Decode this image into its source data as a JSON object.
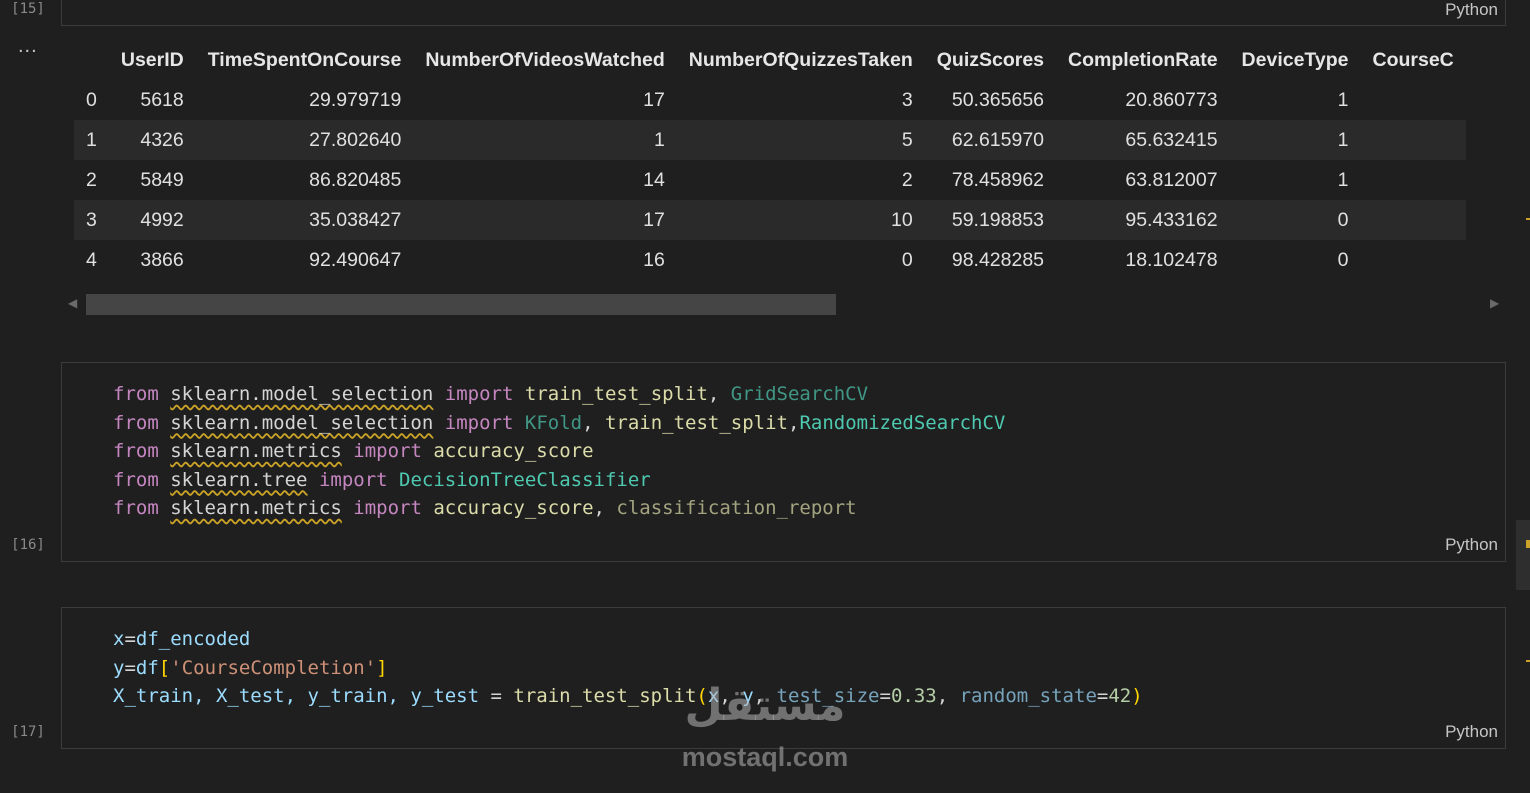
{
  "cells": {
    "c15": {
      "exec": "[15]",
      "lang": "Python"
    },
    "c16": {
      "exec": "[16]",
      "lang": "Python"
    },
    "c17": {
      "exec": "[17]",
      "lang": "Python"
    }
  },
  "output": {
    "ellipsis": "...",
    "columns": [
      "",
      "UserID",
      "TimeSpentOnCourse",
      "NumberOfVideosWatched",
      "NumberOfQuizzesTaken",
      "QuizScores",
      "CompletionRate",
      "DeviceType",
      "CourseC"
    ],
    "rows": [
      [
        "0",
        "5618",
        "29.979719",
        "17",
        "3",
        "50.365656",
        "20.860773",
        "1"
      ],
      [
        "1",
        "4326",
        "27.802640",
        "1",
        "5",
        "62.615970",
        "65.632415",
        "1"
      ],
      [
        "2",
        "5849",
        "86.820485",
        "14",
        "2",
        "78.458962",
        "63.812007",
        "1"
      ],
      [
        "3",
        "4992",
        "35.038427",
        "17",
        "10",
        "59.198853",
        "95.433162",
        "0"
      ],
      [
        "4",
        "3866",
        "92.490647",
        "16",
        "0",
        "98.428285",
        "18.102478",
        "0"
      ]
    ]
  },
  "code16": {
    "l1": {
      "from": "from",
      "mod": "sklearn.model_selection",
      "imp": "import",
      "a": "train_test_split",
      "sep": ", ",
      "b": "GridSearchCV"
    },
    "l2": {
      "from": "from",
      "mod": "sklearn.model_selection",
      "imp": "import",
      "a": "KFold",
      "sep": ", ",
      "b": "train_test_split",
      "sep2": ",",
      "c": "RandomizedSearchCV"
    },
    "l3": {
      "from": "from",
      "mod": "sklearn.metrics",
      "imp": "import",
      "a": "accuracy_score"
    },
    "l4": {
      "from": "from",
      "mod": "sklearn.tree",
      "imp": "import",
      "a": "DecisionTreeClassifier"
    },
    "l5": {
      "from": "from",
      "mod": "sklearn.metrics",
      "imp": "import",
      "a": "accuracy_score",
      "sep": ", ",
      "b": "classification_report"
    }
  },
  "code17": {
    "l1": {
      "v": "x",
      "eq": "=",
      "r": "df_encoded"
    },
    "l2": {
      "v": "y",
      "eq": "=",
      "r": "df",
      "b1": "[",
      "s": "'CourseCompletion'",
      "b2": "]"
    },
    "l3": {
      "lhs": "X_train, X_test, y_train, y_test",
      "eq": " = ",
      "fn": "train_test_split",
      "po": "(",
      "a1": "x",
      "c1": ", ",
      "a2": "y",
      "c2": ", ",
      "p1": "test_size",
      "e1": "=",
      "n1": "0.33",
      "c3": ", ",
      "p2": "random_state",
      "e2": "=",
      "n2": "42",
      "pc": ")"
    }
  },
  "watermark": {
    "arabic": "مستقل",
    "latin": "mostaql.com"
  }
}
